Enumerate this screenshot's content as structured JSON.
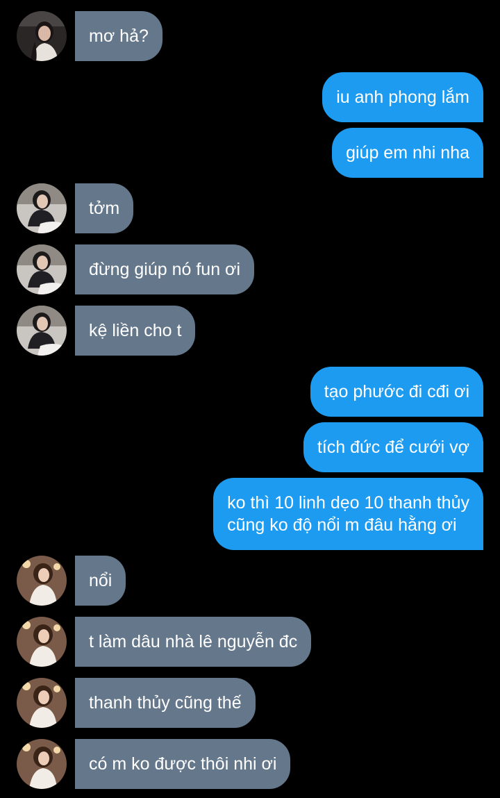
{
  "conversation": {
    "messages": [
      {
        "sender": "them",
        "text": "mơ hả?"
      },
      {
        "sender": "me",
        "text": "iu anh phong lắm"
      },
      {
        "sender": "me",
        "text": "giúp em nhi nha"
      },
      {
        "sender": "them",
        "text": "tởm"
      },
      {
        "sender": "them",
        "text": "đừng giúp nó fun ơi"
      },
      {
        "sender": "them",
        "text": "kệ liền cho t"
      },
      {
        "sender": "me",
        "text": "tạo phước đi cđi ơi"
      },
      {
        "sender": "me",
        "text": "tích đức để cưới vợ"
      },
      {
        "sender": "me",
        "lines": [
          "ko thì 10 linh dẹo 10 thanh thủy",
          "cũng ko độ nổi m đâu hằng ơi"
        ]
      },
      {
        "sender": "them",
        "text": "nổi"
      },
      {
        "sender": "them",
        "text": "t làm dâu nhà lê nguyễn đc"
      },
      {
        "sender": "them",
        "text": "thanh thủy cũng thế"
      },
      {
        "sender": "them",
        "text": "có m ko được thôi nhi ơi"
      }
    ]
  },
  "colors": {
    "background": "#000000",
    "incoming_bubble": "#65778a",
    "outgoing_bubble": "#1d9bf0",
    "text": "#ffffff"
  }
}
